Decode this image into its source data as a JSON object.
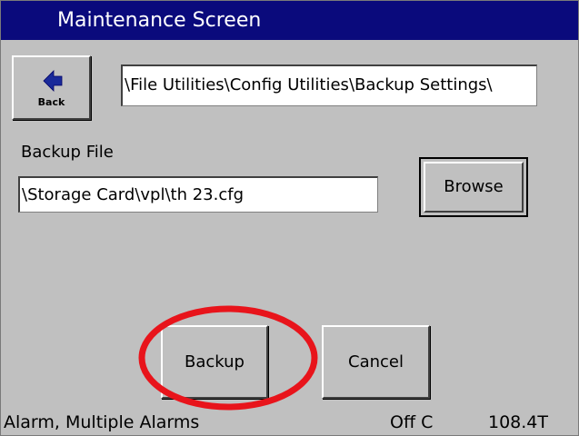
{
  "window": {
    "title": "Maintenance Screen"
  },
  "toolbar": {
    "back_label": "Back",
    "path": "\\File Utilities\\Config Utilities\\Backup Settings\\"
  },
  "backup_file": {
    "label": "Backup File",
    "value": "\\Storage Card\\vpl\\th 23.cfg",
    "browse_label": "Browse"
  },
  "actions": {
    "backup_label": "Backup",
    "cancel_label": "Cancel"
  },
  "status": {
    "message": "Alarm, Multiple Alarms",
    "mode": "Off C",
    "value": "108.4T"
  },
  "colors": {
    "titlebar": "#0a0a7c",
    "background": "#c0c0c0",
    "highlight": "#e8141b"
  },
  "icons": {
    "back": "left-arrow-icon"
  }
}
